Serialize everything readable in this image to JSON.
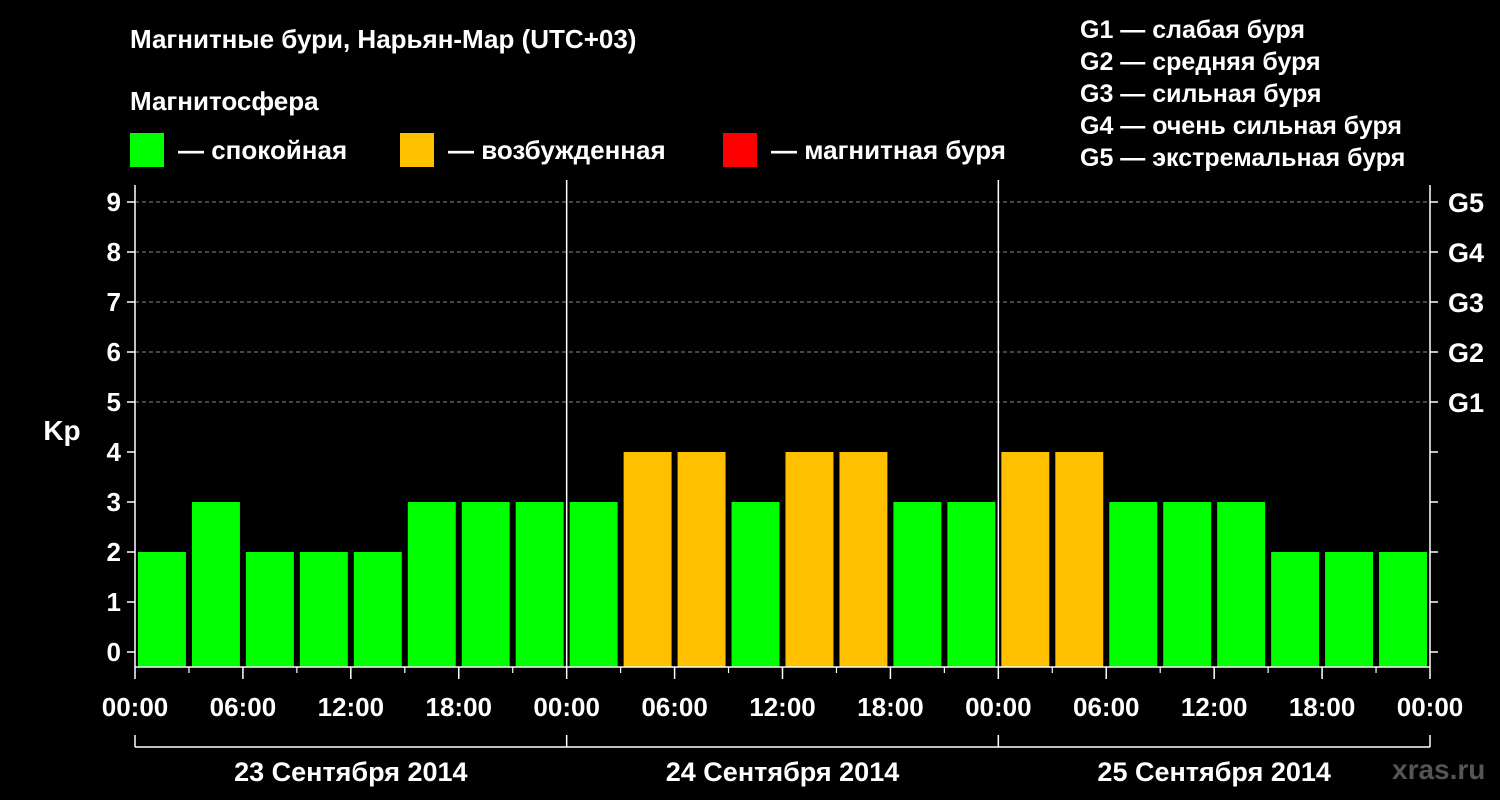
{
  "title": "Магнитные бури, Нарьян-Мар (UTC+03)",
  "magnetosphere_heading": "Магнитосфера",
  "legend": [
    {
      "color": "#00ff00",
      "label": "— спокойная"
    },
    {
      "color": "#ffc000",
      "label": "— возбужденная"
    },
    {
      "color": "#ff0000",
      "label": "— магнитная буря"
    }
  ],
  "storm_levels": [
    "G1 — слабая буря",
    "G2 — средняя буря",
    "G3 — сильная буря",
    "G4 — очень сильная буря",
    "G5 — экстремальная буря"
  ],
  "watermark": "xras.ru",
  "chart_data": {
    "type": "bar",
    "ylabel": "Kp",
    "ylim": [
      0,
      9
    ],
    "y_ticks": [
      0,
      1,
      2,
      3,
      4,
      5,
      6,
      7,
      8,
      9
    ],
    "right_axis_labels": [
      {
        "kp": 5,
        "label": "G1"
      },
      {
        "kp": 6,
        "label": "G2"
      },
      {
        "kp": 7,
        "label": "G3"
      },
      {
        "kp": 8,
        "label": "G4"
      },
      {
        "kp": 9,
        "label": "G5"
      }
    ],
    "x_tick_labels": [
      "00:00",
      "06:00",
      "12:00",
      "18:00",
      "00:00",
      "06:00",
      "12:00",
      "18:00",
      "00:00",
      "06:00",
      "12:00",
      "18:00",
      "00:00"
    ],
    "days": [
      "23 Сентября 2014",
      "24 Сентября 2014",
      "25 Сентября 2014"
    ],
    "interval_hours": 3,
    "values": [
      2,
      3,
      2,
      2,
      2,
      3,
      3,
      3,
      3,
      4,
      4,
      3,
      4,
      4,
      3,
      3,
      4,
      4,
      3,
      3,
      3,
      2,
      2,
      2
    ],
    "status": [
      "quiet",
      "quiet",
      "quiet",
      "quiet",
      "quiet",
      "quiet",
      "quiet",
      "quiet",
      "quiet",
      "active",
      "active",
      "quiet",
      "active",
      "active",
      "quiet",
      "quiet",
      "active",
      "active",
      "quiet",
      "quiet",
      "quiet",
      "quiet",
      "quiet",
      "quiet"
    ],
    "colors": {
      "quiet": "#00ff00",
      "active": "#ffc000",
      "storm": "#ff0000"
    },
    "grid": "dashed horizontal at 5-9"
  }
}
